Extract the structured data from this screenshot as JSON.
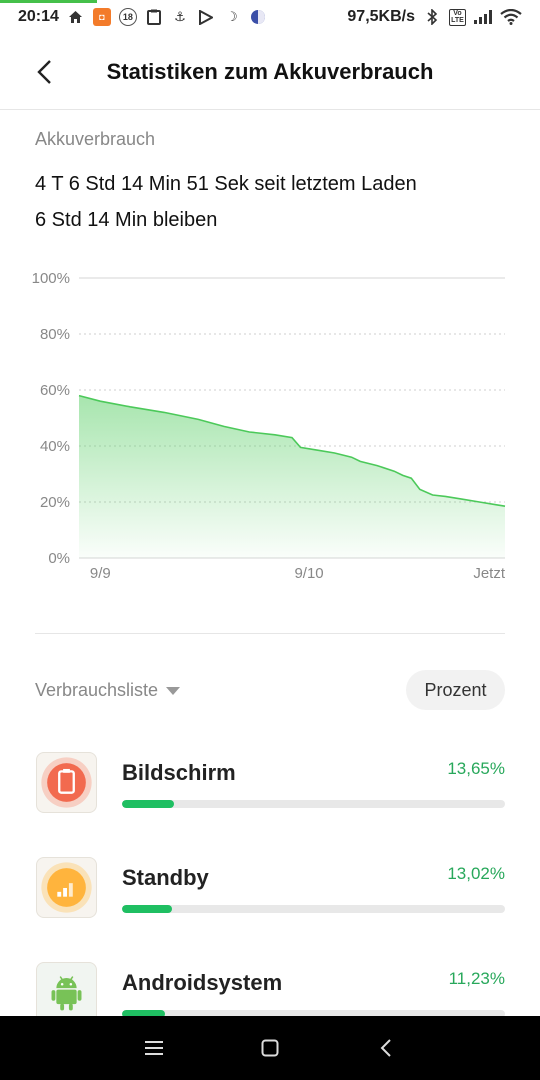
{
  "statusbar": {
    "time": "20:14",
    "notification_badge": "18",
    "net_speed": "97,5KB/s",
    "volte": "Vo LTE"
  },
  "header": {
    "title": "Statistiken zum Akkuverbrauch"
  },
  "summary": {
    "section_label": "Akkuverbrauch",
    "since_charge": "4 T 6 Std 14 Min 51 Sek seit letztem Laden",
    "remaining": "6 Std 14 Min bleiben"
  },
  "chart_data": {
    "type": "area",
    "title": "",
    "xlabel": "",
    "ylabel": "",
    "ylim": [
      0,
      100
    ],
    "y_ticks": [
      "100%",
      "80%",
      "60%",
      "40%",
      "20%",
      "0%"
    ],
    "x_ticks": [
      "9/9",
      "9/10",
      "Jetzt"
    ],
    "x_tick_positions": [
      0.05,
      0.54,
      1.0
    ],
    "x": [
      0.0,
      0.05,
      0.12,
      0.2,
      0.28,
      0.34,
      0.4,
      0.46,
      0.5,
      0.52,
      0.56,
      0.6,
      0.64,
      0.66,
      0.7,
      0.74,
      0.76,
      0.78,
      0.8,
      0.83,
      0.86,
      0.9,
      0.94,
      0.98,
      1.0
    ],
    "values": [
      58,
      56,
      54,
      52,
      49.5,
      47,
      45,
      44,
      43,
      39.5,
      38.5,
      37.5,
      36,
      34.5,
      33,
      31,
      29.5,
      28.5,
      24.5,
      22.5,
      22,
      21,
      20,
      19,
      18.5
    ],
    "grid": true,
    "color": "#4cc95a"
  },
  "list": {
    "sort_label": "Verbrauchsliste",
    "mode_button": "Prozent",
    "items": [
      {
        "name": "Bildschirm",
        "percent": "13,65%",
        "fraction": 0.1365,
        "icon": "screen-icon",
        "icon_color": "#f26a4f"
      },
      {
        "name": "Standby",
        "percent": "13,02%",
        "fraction": 0.1302,
        "icon": "signal-icon",
        "icon_color": "#ffb43d"
      },
      {
        "name": "Androidsystem",
        "percent": "11,23%",
        "fraction": 0.1123,
        "icon": "android-icon",
        "icon_color": "#78c257"
      }
    ]
  }
}
